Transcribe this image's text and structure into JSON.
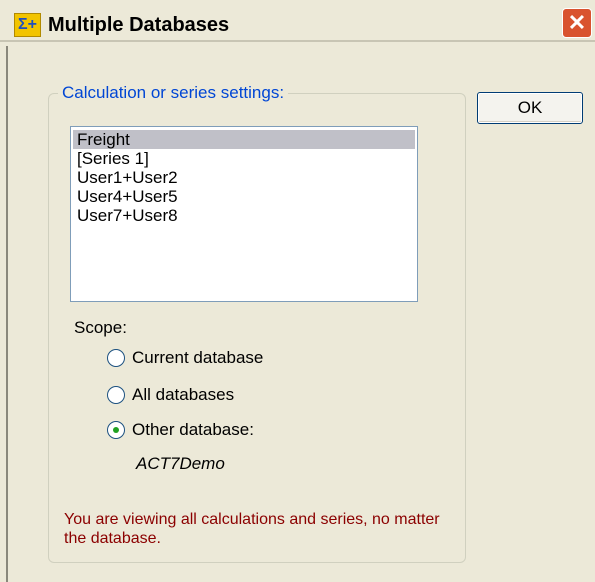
{
  "window": {
    "icon": "sigma-plus-icon",
    "title": "Multiple Databases",
    "close_glyph": "✕"
  },
  "group": {
    "legend": "Calculation or series settings:"
  },
  "buttons": {
    "ok_label": "OK"
  },
  "list": {
    "items": [
      "Freight",
      "[Series 1]",
      "User1+User2",
      "User4+User5",
      "User7+User8"
    ],
    "selected_index": 0
  },
  "scope": {
    "label": "Scope:",
    "options": [
      "Current database",
      "All databases",
      "Other database:"
    ],
    "selected_index": 2,
    "other_database_name": "ACT7Demo"
  },
  "note": "You are viewing all calculations and series, no matter the database.",
  "colors": {
    "legend": "#0046d5",
    "note": "#8b0000",
    "radio_selected": "#21a121",
    "close_button": "#d9532f"
  }
}
